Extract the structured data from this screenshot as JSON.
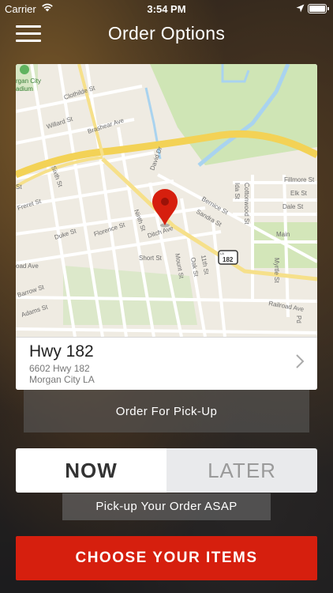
{
  "status_bar": {
    "carrier": "Carrier",
    "time": "3:54 PM",
    "icons": [
      "wifi-icon",
      "location-arrow-icon",
      "battery-icon"
    ]
  },
  "nav": {
    "menu_icon": "hamburger-menu-icon",
    "title": "Order Options"
  },
  "map": {
    "labels": {
      "stadium_1": "rgan City",
      "stadium_2": "adium",
      "clothilde": "Clothilde St",
      "willard": "Willard St",
      "brashear": "Brashear Ave",
      "david": "David Dr",
      "sixth": "Sixth St",
      "freret": "Freret St",
      "duke": "Duke St",
      "florence": "Florence St",
      "ninth": "Ninth St",
      "ditch": "Ditch Ave",
      "short": "Short St",
      "mount": "Mount St",
      "oak": "Oak St",
      "eleventh": "11th St",
      "bernice": "Bernice St",
      "sandra": "Sandra St",
      "ida": "Ida St",
      "cottonwood": "Cottonwood St",
      "fillmore": "Fillmore St",
      "elk": "Elk St",
      "dale": "Dale St",
      "main": "Main",
      "myrtle": "Myrtle St",
      "railroad": "Railroad Ave",
      "road": "oad Ave",
      "barrow": "Barrow St",
      "adams": "Adams St",
      "st_left": "St",
      "pd": "Pd",
      "shield": "182",
      "shield_state": "LA"
    },
    "pin_icon": "map-pin-icon",
    "accent_color": "#d61f0e"
  },
  "location": {
    "name": "Hwy 182",
    "address_line1": "6602 Hwy 182",
    "address_line2": "Morgan City LA",
    "chevron_icon": "chevron-right-icon"
  },
  "order_type": {
    "label": "Order For Pick-Up"
  },
  "timing": {
    "now_label": "NOW",
    "later_label": "LATER",
    "selected": "NOW",
    "hint": "Pick-up Your Order ASAP"
  },
  "cta": {
    "label": "CHOOSE YOUR ITEMS",
    "color": "#d61f0e"
  }
}
